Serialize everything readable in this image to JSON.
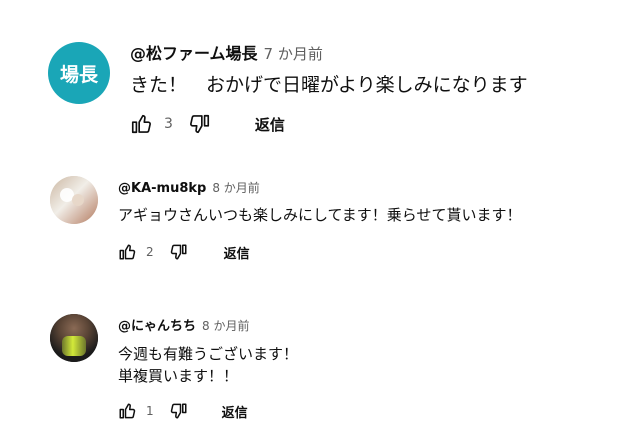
{
  "comments": [
    {
      "avatar_text": "場長",
      "avatar_color": "#1aa6b7",
      "author": "@松ファーム場長",
      "time": "7 か月前",
      "text": "きた！　おかげで日曜がより楽しみになります",
      "likes": "3",
      "reply_label": "返信"
    },
    {
      "author": "@KA-mu8kp",
      "time": "8 か月前",
      "text": "アギョウさんいつも楽しみにしてます！乗らせて貰います！",
      "likes": "2",
      "reply_label": "返信"
    },
    {
      "author": "@にゃんちち",
      "time": "8 か月前",
      "text": "今週も有難うございます！\n単複買います！！",
      "likes": "1",
      "reply_label": "返信"
    }
  ],
  "icons": {
    "like": "thumb-up-icon",
    "dislike": "thumb-down-icon"
  }
}
